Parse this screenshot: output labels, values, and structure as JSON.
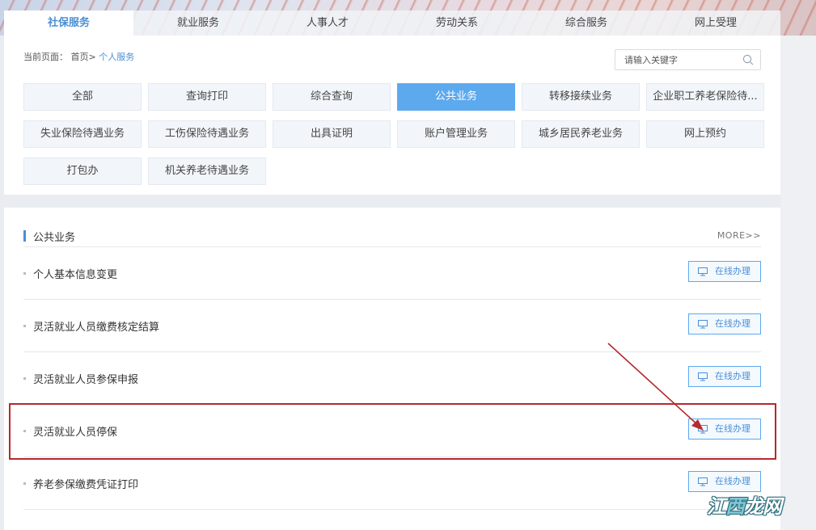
{
  "nav": {
    "tabs": [
      {
        "label": "社保服务",
        "active": true
      },
      {
        "label": "就业服务",
        "active": false
      },
      {
        "label": "人事人才",
        "active": false
      },
      {
        "label": "劳动关系",
        "active": false
      },
      {
        "label": "综合服务",
        "active": false
      },
      {
        "label": "网上受理",
        "active": false
      }
    ]
  },
  "breadcrumb": {
    "prefix": "当前页面：",
    "home": "首页>",
    "current": "个人服务"
  },
  "search": {
    "placeholder": "请输入关键字",
    "icon": "search-icon"
  },
  "categories": [
    {
      "label": "全部",
      "active": false
    },
    {
      "label": "查询打印",
      "active": false
    },
    {
      "label": "综合查询",
      "active": false
    },
    {
      "label": "公共业务",
      "active": true
    },
    {
      "label": "转移接续业务",
      "active": false
    },
    {
      "label": "企业职工养老保险待...",
      "active": false
    },
    {
      "label": "失业保险待遇业务",
      "active": false
    },
    {
      "label": "工伤保险待遇业务",
      "active": false
    },
    {
      "label": "出具证明",
      "active": false
    },
    {
      "label": "账户管理业务",
      "active": false
    },
    {
      "label": "城乡居民养老业务",
      "active": false
    },
    {
      "label": "网上预约",
      "active": false
    },
    {
      "label": "打包办",
      "active": false
    },
    {
      "label": "机关养老待遇业务",
      "active": false
    }
  ],
  "section": {
    "title": "公共业务",
    "more": "MORE>>"
  },
  "services": [
    {
      "name": "个人基本信息变更",
      "action": "在线办理"
    },
    {
      "name": "灵活就业人员缴费核定结算",
      "action": "在线办理"
    },
    {
      "name": "灵活就业人员参保申报",
      "action": "在线办理"
    },
    {
      "name": "灵活就业人员停保",
      "action": "在线办理",
      "highlighted": true
    },
    {
      "name": "养老参保缴费凭证打印",
      "action": "在线办理"
    }
  ],
  "annotation": {
    "color": "#b52a2f"
  },
  "watermark": {
    "text_a": "江",
    "text_b": "西",
    "text_c": "龙网"
  },
  "colors": {
    "accent": "#4a8fd6",
    "active_bg": "#5da9ee"
  }
}
